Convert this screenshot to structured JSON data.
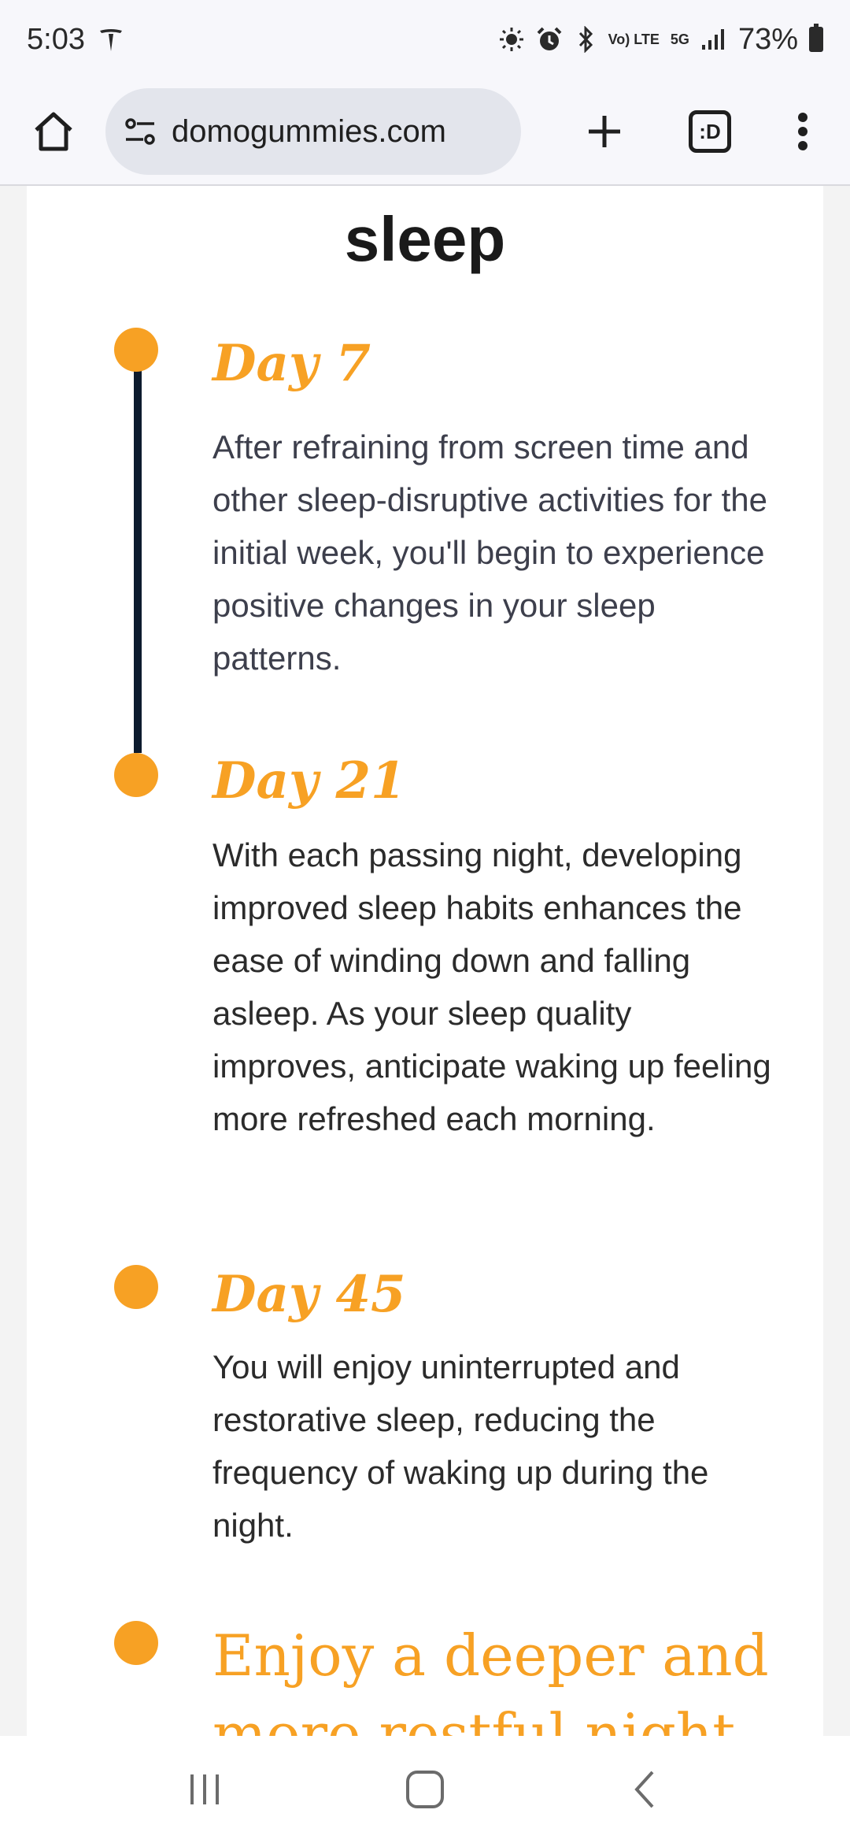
{
  "status_bar": {
    "time": "5:03",
    "battery_percent": "73%",
    "icons": [
      "tesla-icon",
      "brightness-icon",
      "alarm-icon",
      "bluetooth-icon",
      "volte-icon",
      "5g-icon",
      "signal-icon",
      "battery-icon"
    ],
    "volte_label": "Vo) LTE",
    "network_label": "5G"
  },
  "browser": {
    "url": "domogummies.com",
    "tab_icon_label": ":D"
  },
  "page": {
    "heading": "sleep",
    "timeline": [
      {
        "title": "Day 7",
        "text": "After refraining from screen time and other sleep-disruptive activities for the initial week, you'll begin to experience positive changes in your sleep patterns."
      },
      {
        "title": "Day 21",
        "text": "With each passing night, developing improved sleep habits enhances the ease of winding down and falling asleep. As your sleep quality improves, anticipate waking up feeling more refreshed each morning."
      },
      {
        "title": "Day 45",
        "text": "You will enjoy uninterrupted and restorative sleep, reducing the frequency of waking up during the night."
      }
    ],
    "final_title": "Enjoy a deeper and more restful night"
  },
  "colors": {
    "accent": "#f7a124",
    "timeline_line": "#0d1b2e",
    "text": "#2b2b2b"
  }
}
